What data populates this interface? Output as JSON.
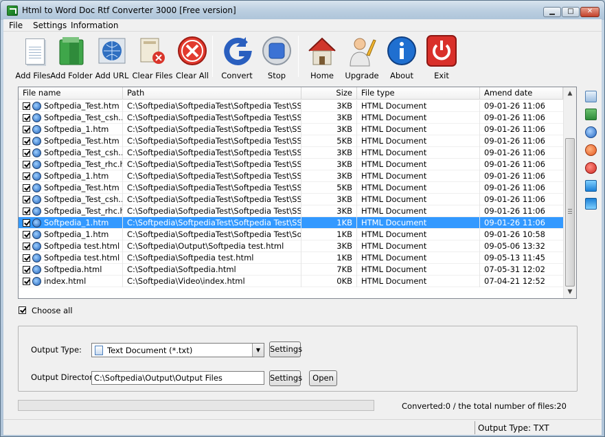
{
  "window": {
    "title": "Html to Word Doc Rtf Converter 3000 [Free version]",
    "controls": {
      "minimize": "▁",
      "maximize": "□",
      "close": "✕"
    }
  },
  "menu": [
    "File",
    "Settings",
    "Information"
  ],
  "toolbar": [
    {
      "label": "Add Files",
      "icon": "page-icon"
    },
    {
      "label": "Add Folder",
      "icon": "folder-icon"
    },
    {
      "label": "Add URL",
      "icon": "globe-icon"
    },
    {
      "label": "Clear Files",
      "icon": "clear-files-icon"
    },
    {
      "label": "Clear All",
      "icon": "clear-all-icon"
    },
    {
      "label": "Convert",
      "icon": "convert-icon"
    },
    {
      "label": "Stop",
      "icon": "stop-icon"
    },
    {
      "label": "Home",
      "icon": "home-icon"
    },
    {
      "label": "Upgrade",
      "icon": "upgrade-icon"
    },
    {
      "label": "About",
      "icon": "info-icon"
    },
    {
      "label": "Exit",
      "icon": "power-icon"
    }
  ],
  "table": {
    "columns": [
      "File name",
      "Path",
      "Size",
      "File type",
      "Amend date"
    ],
    "rows": [
      {
        "name": "Softpedia_Test.htm",
        "path": "C:\\Softpedia\\SoftpediaTest\\Softpedia Test\\SSL!...",
        "size": "3KB",
        "type": "HTML Document",
        "date": "09-01-26 11:06",
        "selected": false
      },
      {
        "name": "Softpedia_Test_csh....",
        "path": "C:\\Softpedia\\SoftpediaTest\\Softpedia Test\\SSL!...",
        "size": "3KB",
        "type": "HTML Document",
        "date": "09-01-26 11:06",
        "selected": false
      },
      {
        "name": "Softpedia_1.htm",
        "path": "C:\\Softpedia\\SoftpediaTest\\Softpedia Test\\SSL!...",
        "size": "3KB",
        "type": "HTML Document",
        "date": "09-01-26 11:06",
        "selected": false
      },
      {
        "name": "Softpedia_Test.htm",
        "path": "C:\\Softpedia\\SoftpediaTest\\Softpedia Test\\SSL!...",
        "size": "5KB",
        "type": "HTML Document",
        "date": "09-01-26 11:06",
        "selected": false
      },
      {
        "name": "Softpedia_Test_csh....",
        "path": "C:\\Softpedia\\SoftpediaTest\\Softpedia Test\\SSL!...",
        "size": "3KB",
        "type": "HTML Document",
        "date": "09-01-26 11:06",
        "selected": false
      },
      {
        "name": "Softpedia_Test_rhc.h...",
        "path": "C:\\Softpedia\\SoftpediaTest\\Softpedia Test\\SSL!...",
        "size": "3KB",
        "type": "HTML Document",
        "date": "09-01-26 11:06",
        "selected": false
      },
      {
        "name": "Softpedia_1.htm",
        "path": "C:\\Softpedia\\SoftpediaTest\\Softpedia Test\\SSL!...",
        "size": "3KB",
        "type": "HTML Document",
        "date": "09-01-26 11:06",
        "selected": false
      },
      {
        "name": "Softpedia_Test.htm",
        "path": "C:\\Softpedia\\SoftpediaTest\\Softpedia Test\\SSL!...",
        "size": "5KB",
        "type": "HTML Document",
        "date": "09-01-26 11:06",
        "selected": false
      },
      {
        "name": "Softpedia_Test_csh....",
        "path": "C:\\Softpedia\\SoftpediaTest\\Softpedia Test\\SSL!...",
        "size": "3KB",
        "type": "HTML Document",
        "date": "09-01-26 11:06",
        "selected": false
      },
      {
        "name": "Softpedia_Test_rhc.h...",
        "path": "C:\\Softpedia\\SoftpediaTest\\Softpedia Test\\SSL!...",
        "size": "3KB",
        "type": "HTML Document",
        "date": "09-01-26 11:06",
        "selected": false
      },
      {
        "name": "Softpedia_1.htm",
        "path": "C:\\Softpedia\\SoftpediaTest\\Softpedia Test\\SSL!...",
        "size": "1KB",
        "type": "HTML Document",
        "date": "09-01-26 11:06",
        "selected": true
      },
      {
        "name": "Softpedia_1.htm",
        "path": "C:\\Softpedia\\SoftpediaTest\\Softpedia Test\\Softp...",
        "size": "1KB",
        "type": "HTML Document",
        "date": "09-01-26 10:58",
        "selected": false
      },
      {
        "name": "Softpedia test.html",
        "path": "C:\\Softpedia\\Output\\Softpedia test.html",
        "size": "3KB",
        "type": "HTML Document",
        "date": "09-05-06 13:32",
        "selected": false
      },
      {
        "name": "Softpedia test.html",
        "path": "C:\\Softpedia\\Softpedia test.html",
        "size": "1KB",
        "type": "HTML Document",
        "date": "09-05-13 11:45",
        "selected": false
      },
      {
        "name": "Softpedia.html",
        "path": "C:\\Softpedia\\Softpedia.html",
        "size": "7KB",
        "type": "HTML Document",
        "date": "07-05-31 12:02",
        "selected": false
      },
      {
        "name": "index.html",
        "path": "C:\\Softpedia\\Video\\index.html",
        "size": "0KB",
        "type": "HTML Document",
        "date": "07-04-21 12:52",
        "selected": false
      }
    ],
    "scroll_up": "▲",
    "scroll_down": "▼"
  },
  "choose_all": {
    "label": "Choose all",
    "checked": true
  },
  "output": {
    "type_label": "Output Type:",
    "type_value": "Text Document (*.txt)",
    "type_arrow": "▼",
    "settings_label": "Settings",
    "dir_label": "Output Directory:",
    "dir_value": "C:\\Softpedia\\Output\\Output Files",
    "dir_settings_label": "Settings",
    "open_label": "Open"
  },
  "progress": {
    "converted_text": "Converted:0  /  the total number of files:20"
  },
  "statusbar": {
    "text": "Output Type: TXT"
  }
}
